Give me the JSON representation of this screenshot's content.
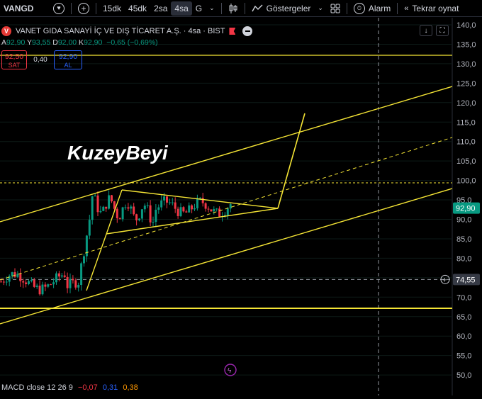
{
  "toolbar": {
    "symbol": "VANGD",
    "timeframes": [
      "15dk",
      "45dk",
      "2sa",
      "4sa",
      "G"
    ],
    "active_timeframe": "4sa",
    "indicators_label": "Göstergeler",
    "alert_label": "Alarm",
    "replay_label": "Tekrar oynat"
  },
  "header": {
    "title": "VANET GIDA SANAYİ İÇ VE DIŞ TİCARET A.Ş. · 4sa · BIST",
    "logo_letter": "V"
  },
  "ohlc": {
    "a_key": "A",
    "a_val": "92,90",
    "y_key": "Y",
    "y_val": "93,55",
    "d_key": "D",
    "d_val": "92,00",
    "k_key": "K",
    "k_val": "92,90",
    "change": "−0,65 (−0,69%)"
  },
  "trade": {
    "sell_price": "92,50",
    "sell_label": "SAT",
    "spread": "0,40",
    "buy_price": "92,90",
    "buy_label": "AL"
  },
  "watermark": "KuzeyBeyi",
  "price_axis": {
    "ticks": [
      "140,0",
      "135,0",
      "130,0",
      "125,0",
      "120,0",
      "115,0",
      "110,0",
      "105,0",
      "100,0",
      "95,0",
      "90,0",
      "85,0",
      "80,0",
      "75,0",
      "70,0",
      "65,0",
      "60,0",
      "55,0",
      "50,0"
    ],
    "current_price": "92,90",
    "crosshair_price": "74,55"
  },
  "macd": {
    "label": "MACD close 12 26 9",
    "v1": "−0,07",
    "v2": "0,31",
    "v3": "0,38"
  },
  "colors": {
    "up": "#089981",
    "down": "#f23645",
    "drawing": "#f5e535",
    "current_price": "#089981"
  }
}
